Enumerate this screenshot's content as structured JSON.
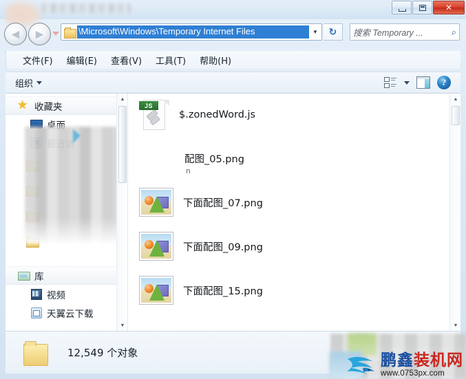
{
  "window": {
    "title": "",
    "controls": {
      "minimize": "minimize",
      "restore": "restore",
      "close": "✕"
    }
  },
  "address_bar": {
    "path_text": "\\Microsoft\\Windows\\Temporary Internet Files",
    "dropdown_glyph": "▼",
    "refresh_glyph": "↻",
    "back_glyph": "◀",
    "forward_glyph": "▶"
  },
  "search": {
    "placeholder": "搜索 Temporary ...",
    "icon_glyph": "⌕"
  },
  "menu": {
    "items": [
      {
        "label": "文件(F)"
      },
      {
        "label": "编辑(E)"
      },
      {
        "label": "查看(V)"
      },
      {
        "label": "工具(T)"
      },
      {
        "label": "帮助(H)"
      }
    ]
  },
  "toolbar": {
    "organize_label": "组织",
    "help_glyph": "?"
  },
  "sidebar": {
    "items": [
      {
        "label": "收藏夹",
        "icon": "star-icon",
        "type": "header"
      },
      {
        "label": "桌面",
        "icon": "monitor-icon",
        "type": "child"
      },
      {
        "label": "最近访",
        "icon": "recent-icon",
        "type": "child"
      },
      {
        "label": "",
        "icon": "folder-icon",
        "type": "blurred"
      },
      {
        "label": "",
        "icon": "folder-icon",
        "type": "blurred"
      },
      {
        "label": "",
        "icon": "folder-icon",
        "type": "blurred"
      },
      {
        "label": "",
        "icon": "folder-icon",
        "type": "blurred"
      },
      {
        "label": "库",
        "icon": "library-icon",
        "type": "header"
      },
      {
        "label": "视频",
        "icon": "video-icon",
        "type": "child"
      },
      {
        "label": "天翼云下载",
        "icon": "cloud-icon",
        "type": "child"
      }
    ]
  },
  "files": [
    {
      "name": "$.zonedWord.js",
      "icon": "js-file-icon",
      "note": ""
    },
    {
      "name": "配图_05.png",
      "icon": "none",
      "note": "n"
    },
    {
      "name": "下面配图_07.png",
      "icon": "png-image-icon",
      "note": ""
    },
    {
      "name": "下面配图_09.png",
      "icon": "png-image-icon",
      "note": ""
    },
    {
      "name": "下面配图_15.png",
      "icon": "png-image-icon",
      "note": ""
    }
  ],
  "status": {
    "count_text": "12,549 个对象"
  },
  "watermark": {
    "name_part1": "鹏鑫",
    "name_part2": "装机网",
    "url": "www.0753px.com"
  },
  "colors": {
    "selection_blue": "#2f7fd4",
    "close_red": "#d8402c",
    "js_badge_green": "#3c8f42",
    "watermark_blue": "#1a4fa0",
    "watermark_red": "#c9271f"
  }
}
